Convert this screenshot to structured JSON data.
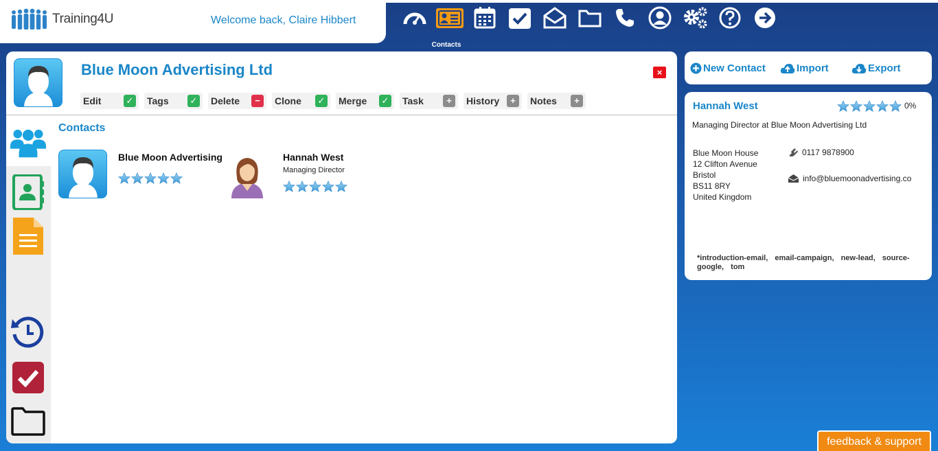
{
  "brand": {
    "name": "Training4U"
  },
  "header": {
    "welcome": "Welcome back, Claire Hibbert"
  },
  "nav": {
    "items": [
      {
        "icon": "dashboard-icon"
      },
      {
        "icon": "contacts-icon",
        "label": "Contacts",
        "active": true
      },
      {
        "icon": "calendar-icon"
      },
      {
        "icon": "tasks-icon"
      },
      {
        "icon": "mail-icon"
      },
      {
        "icon": "folder-icon"
      },
      {
        "icon": "phone-icon"
      },
      {
        "icon": "user-icon"
      },
      {
        "icon": "settings-icon"
      },
      {
        "icon": "help-icon"
      },
      {
        "icon": "logout-icon"
      }
    ],
    "active_label": "Contacts"
  },
  "company": {
    "name": "Blue Moon Advertising Ltd",
    "close": "×"
  },
  "actions": [
    {
      "label": "Edit",
      "state": "✓"
    },
    {
      "label": "Tags",
      "state": "✓"
    },
    {
      "label": "Delete",
      "state": "−"
    },
    {
      "label": "Clone",
      "state": "✓"
    },
    {
      "label": "Merge",
      "state": "✓"
    },
    {
      "label": "Task",
      "state": "+"
    },
    {
      "label": "History",
      "state": "+"
    },
    {
      "label": "Notes",
      "state": "+"
    }
  ],
  "contacts_section": {
    "title": "Contacts",
    "cards": [
      {
        "name": "Blue Moon Advertising Ltd",
        "role": "",
        "rating": 5
      },
      {
        "name": "Hannah West",
        "role": "Managing Director",
        "rating": 5
      }
    ]
  },
  "right_toolbar": {
    "new_contact": "New Contact",
    "import": "Import",
    "export": "Export"
  },
  "contact_detail": {
    "name": "Hannah West",
    "rating": 5,
    "percent": "0%",
    "role": "Managing Director at Blue Moon Advertising Ltd",
    "address": [
      "Blue Moon House",
      "12 Clifton Avenue",
      "Bristol",
      "BS11 8RY",
      "United Kingdom"
    ],
    "phone": "0117 9878900",
    "email": "info@bluemoonadvertising.co",
    "tags": "*introduction-email, email-campaign, new-lead, source-google, tom"
  },
  "footer": {
    "feedback": "feedback & support"
  },
  "colors": {
    "accent": "#1a86c8",
    "orange": "#f08a12",
    "navy": "#1a3f86"
  }
}
